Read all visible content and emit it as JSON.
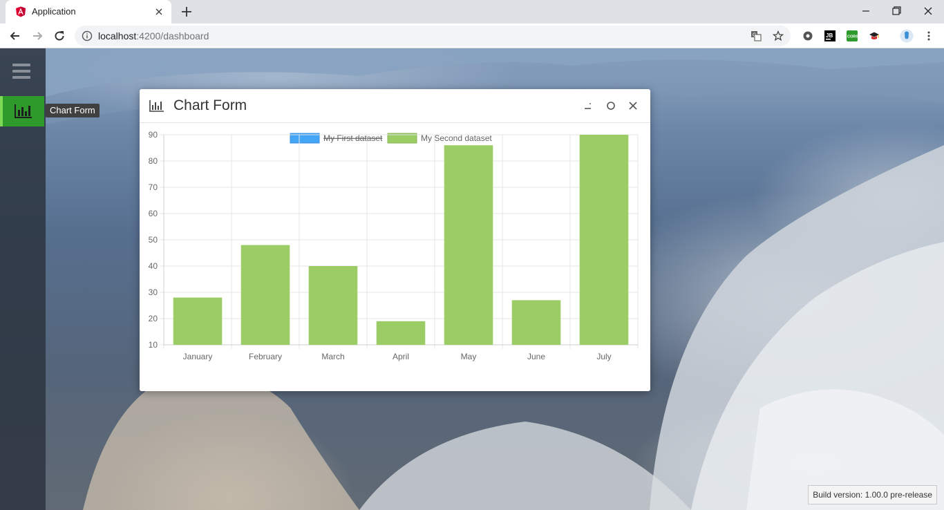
{
  "browser": {
    "tab_title": "Application",
    "url_host": "localhost",
    "url_rest": ":4200/dashboard",
    "extensions": [
      "settings-gear-icon",
      "jetbrains-ide-icon",
      "cors-extension-icon",
      "graduation-cap-icon",
      "user-profile-icon",
      "menu-kebab-icon"
    ]
  },
  "sidebar": {
    "menu_icon": "hamburger-icon",
    "items": [
      {
        "icon": "bar-chart-icon",
        "tooltip": "Chart Form",
        "active": true
      }
    ],
    "accent_color": "#2e9a2c"
  },
  "dialog": {
    "title": "Chart Form",
    "icon": "bar-chart-icon",
    "controls": [
      "minimize-icon",
      "maximize-icon",
      "close-icon"
    ]
  },
  "footer": {
    "build_version": "Build version: 1.00.0 pre-release"
  },
  "chart_data": {
    "type": "bar",
    "categories": [
      "January",
      "February",
      "March",
      "April",
      "May",
      "June",
      "July"
    ],
    "series": [
      {
        "name": "My First dataset",
        "color": "#42a5f5",
        "hidden": true,
        "values": []
      },
      {
        "name": "My Second dataset",
        "color": "#9ccc65",
        "hidden": false,
        "values": [
          28,
          48,
          40,
          19,
          86,
          27,
          90
        ]
      }
    ],
    "ylim": [
      10,
      90
    ],
    "yticks": [
      90,
      80,
      70,
      60,
      50,
      40,
      30,
      20,
      10
    ],
    "grid": true,
    "legend": "top-center"
  }
}
